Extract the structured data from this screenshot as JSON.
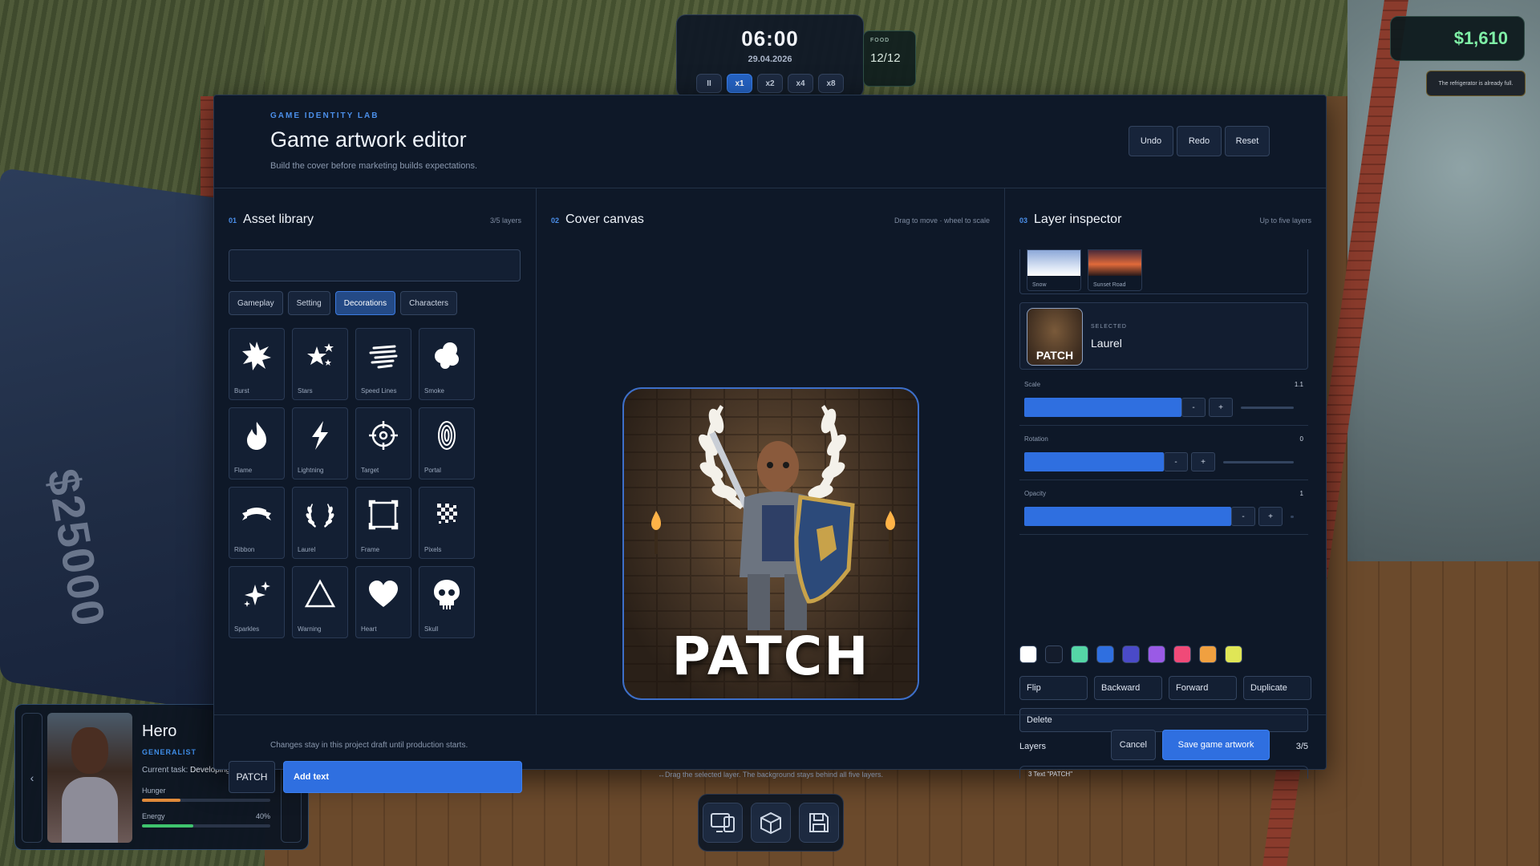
{
  "hud": {
    "time": "06:00",
    "date": "29.04.2026",
    "speeds": [
      "II",
      "x1",
      "x2",
      "x4",
      "x8"
    ],
    "active_speed": "x1",
    "food_label": "FOOD",
    "food_value": "12/12",
    "money": "$1,610",
    "notice": "The refrigerator is already full."
  },
  "world": {
    "floor_price": "$25000"
  },
  "hero": {
    "name": "Hero",
    "role": "GENERALIST",
    "task_label": "Current task:",
    "task_value": "Developing a project",
    "stats": [
      {
        "name": "Hunger",
        "value": "30%",
        "level": 0.3,
        "color": "#e08a3a"
      },
      {
        "name": "Energy",
        "value": "40%",
        "level": 0.4,
        "color": "#3fc46e"
      }
    ]
  },
  "modal": {
    "eyebrow": "GAME IDENTITY LAB",
    "title": "Game artwork editor",
    "subtitle": "Build the cover before marketing builds expectations.",
    "header_buttons": [
      "Undo",
      "Redo",
      "Reset"
    ],
    "footer_note": "Changes stay in this project draft until production starts.",
    "cancel_label": "Cancel",
    "save_label": "Save game artwork"
  },
  "asset_library": {
    "num": "01",
    "title": "Asset library",
    "hint": "3/5 layers",
    "search_value": "",
    "categories": [
      "Gameplay",
      "Setting",
      "Decorations",
      "Characters"
    ],
    "active_category": "Decorations",
    "assets": [
      "Burst",
      "Stars",
      "Speed Lines",
      "Smoke",
      "Flame",
      "Lightning",
      "Target",
      "Portal",
      "Ribbon",
      "Laurel",
      "Frame",
      "Pixels",
      "Sparkles",
      "Warning",
      "Heart",
      "Skull"
    ],
    "text_value": "PATCH",
    "add_text_label": "Add text"
  },
  "canvas": {
    "num": "02",
    "title": "Cover canvas",
    "hint": "Drag to move · wheel to scale",
    "cover_text": "PATCH",
    "footer": "↔Drag the selected layer. The background stays behind all five layers."
  },
  "inspector": {
    "num": "03",
    "title": "Layer inspector",
    "hint": "Up to five layers",
    "backgrounds": [
      "Snow",
      "Sunset Road"
    ],
    "selected_eyebrow": "SELECTED",
    "selected_name": "Laurel",
    "selected_thumb_text": "PATCH",
    "sliders": [
      {
        "label": "Scale",
        "value": "1.1",
        "level": 0.55
      },
      {
        "label": "Rotation",
        "value": "0",
        "level": 0.5
      },
      {
        "label": "Opacity",
        "value": "1",
        "level": 1.0
      }
    ],
    "colors": [
      "#ffffff",
      "#141c2c",
      "#55d6a6",
      "#2f6fe0",
      "#4a4ac8",
      "#9a5ae6",
      "#f04a78",
      "#f0a040",
      "#e0e656"
    ],
    "actions": [
      "Flip",
      "Backward",
      "Forward",
      "Duplicate"
    ],
    "delete_label": "Delete",
    "layers_label": "Layers",
    "layers_count": "3/5",
    "layer_item": "3   Text \"PATCH\""
  }
}
